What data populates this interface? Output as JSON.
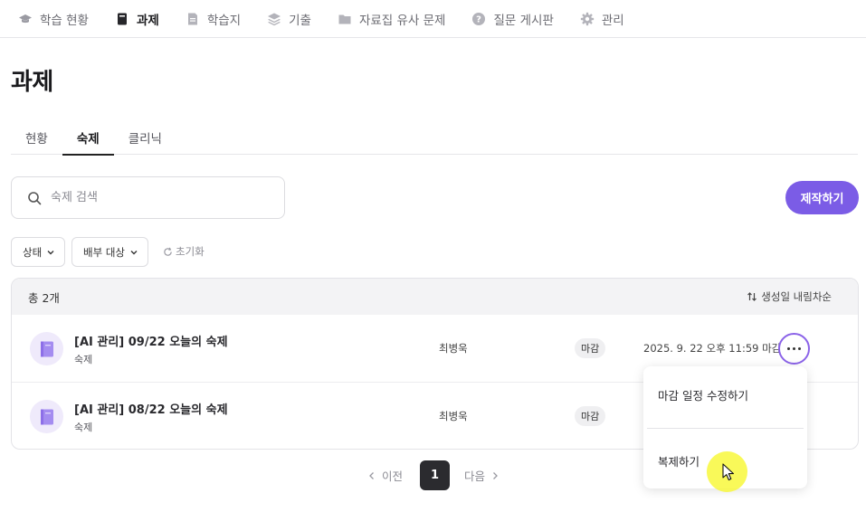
{
  "nav": {
    "items": [
      {
        "label": "학습 현황",
        "icon": "graduation-cap-icon"
      },
      {
        "label": "과제",
        "icon": "document-icon"
      },
      {
        "label": "학습지",
        "icon": "note-icon"
      },
      {
        "label": "기출",
        "icon": "layers-icon"
      },
      {
        "label": "자료집 유사 문제",
        "icon": "folder-icon"
      },
      {
        "label": "질문 게시판",
        "icon": "question-icon"
      },
      {
        "label": "관리",
        "icon": "gear-icon"
      }
    ],
    "active_index": 1
  },
  "page": {
    "title": "과제"
  },
  "tabs": {
    "items": [
      {
        "label": "현황"
      },
      {
        "label": "숙제"
      },
      {
        "label": "클리닉"
      }
    ],
    "active_index": 1
  },
  "search": {
    "placeholder": "숙제 검색",
    "value": ""
  },
  "toolbar": {
    "create_label": "제작하기"
  },
  "filters": {
    "status_label": "상태",
    "target_label": "배부 대상",
    "reset_label": "초기화"
  },
  "list": {
    "total_label": "총 2개",
    "sort_label": "생성일 내림차순",
    "rows": [
      {
        "title": "[AI 관리] 09/22 오늘의 숙제",
        "type": "숙제",
        "author": "최병욱",
        "status": "마감",
        "due": "2025. 9. 22 오후 11:59 마감"
      },
      {
        "title": "[AI 관리] 08/22 오늘의 숙제",
        "type": "숙제",
        "author": "최병욱",
        "status": "마감",
        "due": ""
      }
    ]
  },
  "menu": {
    "items": [
      {
        "label": "마감 일정 수정하기"
      },
      {
        "label": "복제하기"
      }
    ]
  },
  "pagination": {
    "prev_label": "이전",
    "current_page": "1",
    "next_label": "다음"
  },
  "colors": {
    "accent": "#7b5ce6",
    "focus_ring": "#8b63e8",
    "cursor_highlight": "#f8f83c"
  }
}
